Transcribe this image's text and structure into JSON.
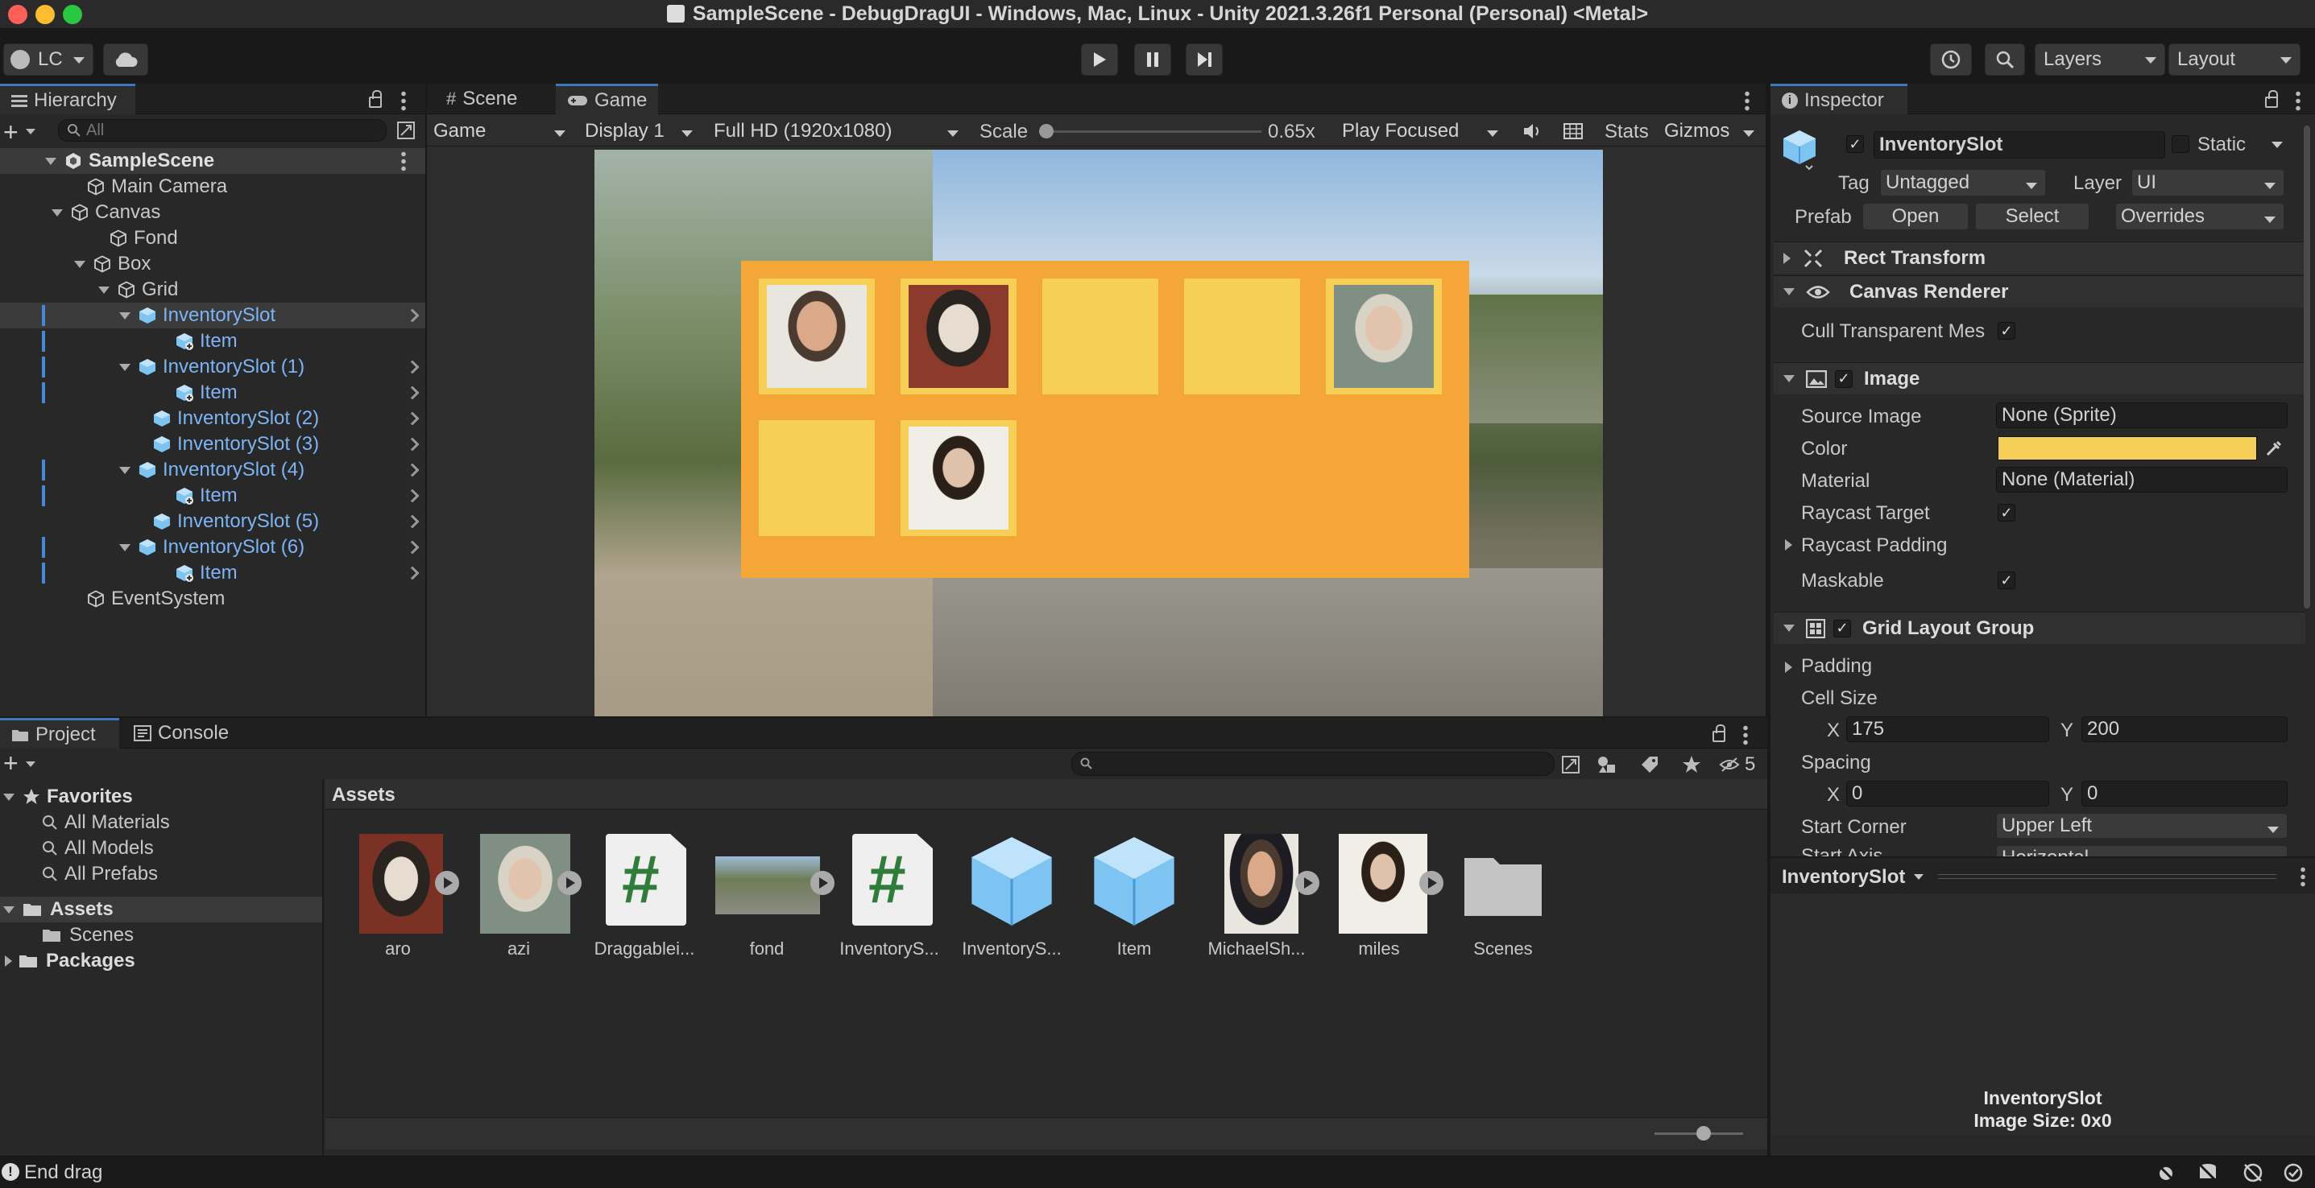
{
  "window": {
    "title": "SampleScene - DebugDragUI - Windows, Mac, Linux - Unity 2021.3.26f1 Personal (Personal) <Metal>"
  },
  "toolbar": {
    "account": "LC",
    "layers": "Layers",
    "layout": "Layout"
  },
  "hierarchy": {
    "tab": "Hierarchy",
    "search_placeholder": "All",
    "scene": "SampleScene",
    "items": [
      "Main Camera",
      "Canvas",
      "Fond",
      "Box",
      "Grid",
      "InventorySlot",
      "Item",
      "InventorySlot (1)",
      "Item",
      "InventorySlot (2)",
      "InventorySlot (3)",
      "InventorySlot (4)",
      "Item",
      "InventorySlot (5)",
      "InventorySlot (6)",
      "Item",
      "EventSystem"
    ]
  },
  "scene_view": {
    "tabs": [
      "Scene",
      "Game"
    ],
    "game_dropdown": "Game",
    "display": "Display 1",
    "resolution": "Full HD (1920x1080)",
    "scale_label": "Scale",
    "scale_value": "0.65x",
    "play_mode": "Play Focused",
    "stats": "Stats",
    "gizmos": "Gizmos"
  },
  "inspector": {
    "tab": "Inspector",
    "object_name": "InventorySlot",
    "static_label": "Static",
    "tag_label": "Tag",
    "tag_value": "Untagged",
    "layer_label": "Layer",
    "layer_value": "UI",
    "prefab_label": "Prefab",
    "prefab_open": "Open",
    "prefab_select": "Select",
    "prefab_overrides": "Overrides",
    "rect_transform": "Rect Transform",
    "canvas_renderer": "Canvas Renderer",
    "cull_label": "Cull Transparent Mes",
    "image": "Image",
    "source_image_label": "Source Image",
    "source_image_value": "None (Sprite)",
    "color_label": "Color",
    "color_value": "#f7cf56",
    "material_label": "Material",
    "material_value": "None (Material)",
    "raycast_target": "Raycast Target",
    "raycast_padding": "Raycast Padding",
    "maskable": "Maskable",
    "grid_layout": "Grid Layout Group",
    "padding": "Padding",
    "cell_size": "Cell Size",
    "cell_x_label": "X",
    "cell_x": "175",
    "cell_y_label": "Y",
    "cell_y": "200",
    "spacing": "Spacing",
    "spacing_x_label": "X",
    "spacing_x": "0",
    "spacing_y_label": "Y",
    "spacing_y": "0",
    "start_corner_label": "Start Corner",
    "start_corner_value": "Upper Left",
    "start_axis_label": "Start Axis",
    "start_axis_value": "Horizontal",
    "preview_dropdown": "InventorySlot",
    "preview_name": "InventorySlot",
    "preview_size": "Image Size: 0x0"
  },
  "project": {
    "tabs": [
      "Project",
      "Console"
    ],
    "hidden_count": "5",
    "favorites": "Favorites",
    "fav_items": [
      "All Materials",
      "All Models",
      "All Prefabs"
    ],
    "assets_folder": "Assets",
    "scenes_folder": "Scenes",
    "packages": "Packages",
    "breadcrumb": "Assets",
    "assets": [
      "aro",
      "azi",
      "Draggablei...",
      "fond",
      "InventoryS...",
      "InventoryS...",
      "Item",
      "MichaelSh...",
      "miles",
      "Scenes"
    ]
  },
  "status": {
    "message": "End drag"
  },
  "colors": {
    "slot": "#f7cf56",
    "panel_bg": "#f4a637",
    "accent": "#3a79bb"
  }
}
